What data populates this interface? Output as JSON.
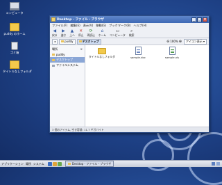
{
  "desktop": {
    "icons": [
      {
        "label": "コンピュータ",
        "icon": "computer-icon"
      },
      {
        "label": "puddy のホーム",
        "icon": "home-folder-icon"
      },
      {
        "label": "ゴミ箱",
        "icon": "trash-icon"
      },
      {
        "label": "タイトルなしフォルダ",
        "icon": "folder-icon"
      }
    ]
  },
  "window": {
    "title": "Desktop - ファイル・ブラウザ",
    "menu": [
      "ファイル(F)",
      "編集(E)",
      "表示(V)",
      "移動(G)",
      "ブックマーク(B)",
      "ヘルプ(H)"
    ],
    "toolbar": [
      {
        "label": "戻る",
        "icon": "back-arrow-icon"
      },
      {
        "label": "進む",
        "icon": "forward-arrow-icon"
      },
      {
        "label": "上へ",
        "icon": "up-arrow-icon"
      },
      {
        "label": "停止",
        "icon": "stop-icon"
      },
      {
        "label": "再読込",
        "icon": "reload-icon"
      },
      {
        "label": "ホーム",
        "icon": "home-icon"
      },
      {
        "label": "コンピュータ",
        "icon": "computer-icon"
      },
      {
        "label": "検索",
        "icon": "search-icon"
      }
    ],
    "location": {
      "crumbs": [
        "puddy",
        "デスクトップ"
      ],
      "zoom": "100%",
      "view_mode": "アイコン表示"
    },
    "sidebar": {
      "header": "場所",
      "items": [
        {
          "label": "puddy",
          "selected": false
        },
        {
          "label": "デスクトップ",
          "selected": true
        },
        {
          "label": "ファイルシステム",
          "selected": false
        }
      ]
    },
    "files": [
      {
        "name": "タイトルなしフォルダ",
        "type": "folder"
      },
      {
        "name": "sample.doc",
        "type": "doc"
      },
      {
        "name": "sample.xls",
        "type": "xls"
      }
    ],
    "status": "3 個のアイテム, 空き容量: 11.7 ギガバイト"
  },
  "taskbar": {
    "menus": [
      "アプリケーション",
      "場所",
      "システム"
    ],
    "task": "Desktop - ファイル・ブラウザ"
  }
}
